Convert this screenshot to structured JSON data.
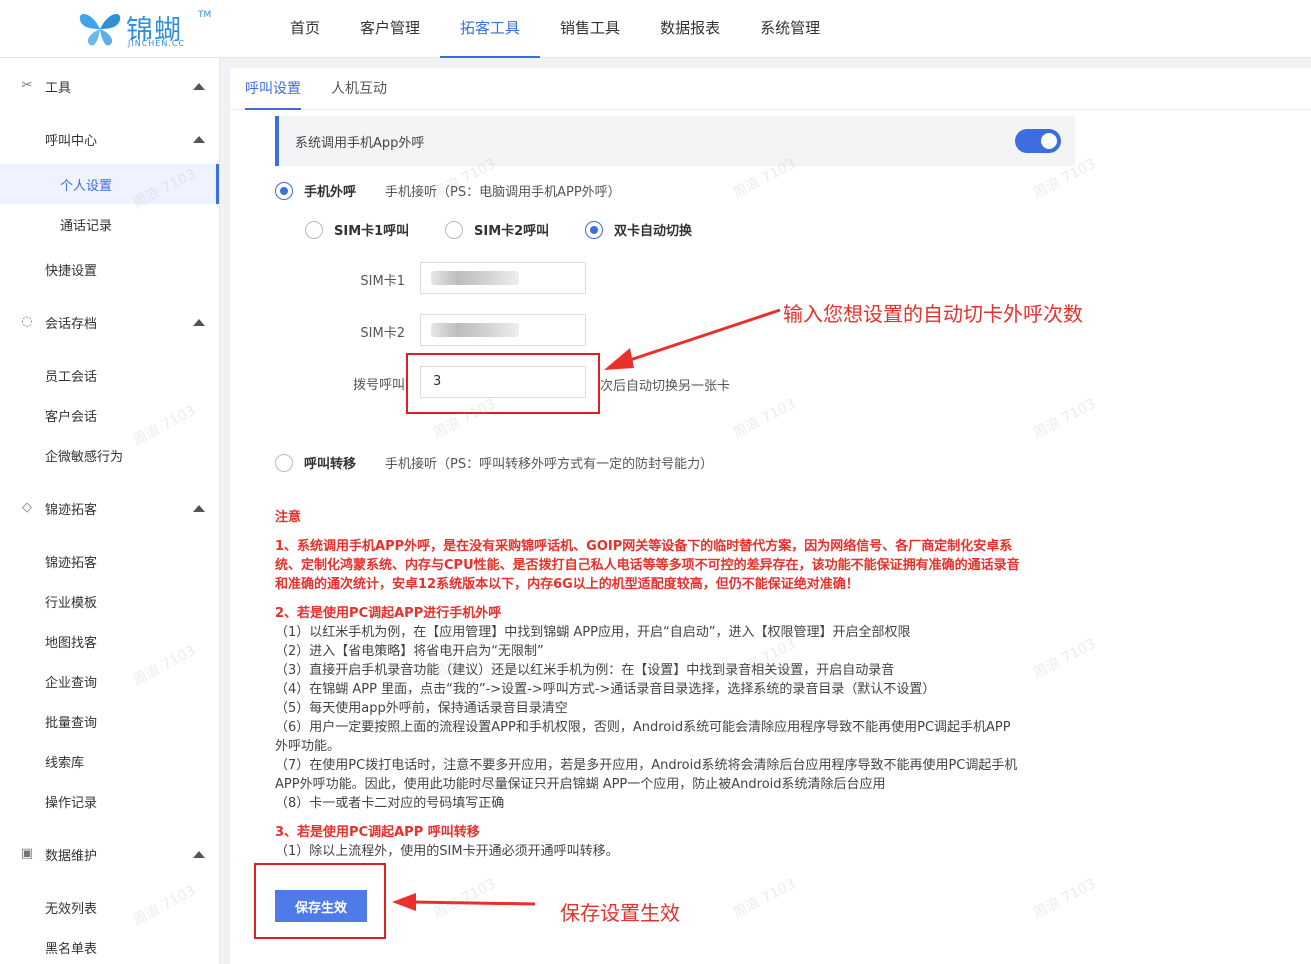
{
  "brand": {
    "name": "锦蝴",
    "tm": "TM",
    "sub": "JINCHEN.CC"
  },
  "nav": [
    {
      "label": "首页",
      "active": false
    },
    {
      "label": "客户管理",
      "active": false
    },
    {
      "label": "拓客工具",
      "active": true
    },
    {
      "label": "销售工具",
      "active": false
    },
    {
      "label": "数据报表",
      "active": false
    },
    {
      "label": "系统管理",
      "active": false
    }
  ],
  "sidebar": {
    "groups": [
      {
        "label": "工具",
        "icon": "tools-icon"
      },
      {
        "label": "会话存档",
        "icon": "chat-icon"
      },
      {
        "label": "锦迹拓客",
        "icon": "diamond-icon"
      },
      {
        "label": "数据维护",
        "icon": "database-icon"
      }
    ],
    "sub_call_center": "呼叫中心",
    "items": {
      "personal_settings": "个人设置",
      "call_records": "通话记录",
      "quick_settings": "快捷设置",
      "employee_chat": "员工会话",
      "customer_chat": "客户会话",
      "sensitive_behavior": "企微敏感行为",
      "jinji_tuoke": "锦迹拓客",
      "industry_template": "行业模板",
      "map_search": "地图找客",
      "enterprise_query": "企业查询",
      "batch_query": "批量查询",
      "leads_library": "线索库",
      "operation_log": "操作记录",
      "invalid_list": "无效列表",
      "blacklist": "黑名单表"
    }
  },
  "tabs": [
    {
      "label": "呼叫设置",
      "active": true
    },
    {
      "label": "人机互动",
      "active": false
    }
  ],
  "settings": {
    "app_call_label": "系统调用手机App外呼",
    "app_call_enabled": true,
    "mobile_call_label": "手机外呼",
    "mobile_call_hint": "手机接听（PS：电脑调用手机APP外呼）",
    "sim_options": [
      {
        "label": "SIM卡1呼叫",
        "checked": false
      },
      {
        "label": "SIM卡2呼叫",
        "checked": false
      },
      {
        "label": "双卡自动切换",
        "checked": true
      }
    ],
    "sim1_label": "SIM卡1",
    "sim2_label": "SIM卡2",
    "dial_label": "拨号呼叫",
    "dial_value": "3",
    "dial_suffix": "次后自动切换另一张卡",
    "forward_label": "呼叫转移",
    "forward_hint": "手机接听（PS：呼叫转移外呼方式有一定的防封号能力）"
  },
  "notes": {
    "title": "注意",
    "n1_lines": [
      "1、系统调用手机APP外呼，是在没有采购锦呼话机、GOIP网关等设备下的临时替代方案，因为网络信号、各厂商定制化安卓系",
      "统、定制化鸿蒙系统、内存与CPU性能、是否拨打自己私人电话等等多项不可控的差异存在，该功能不能保证拥有准确的通话录音",
      "和准确的通次统计，安卓12系统版本以下，内存6G以上的机型适配度较高，但仍不能保证绝对准确！"
    ],
    "n2_title": "2、若是使用PC调起APP进行手机外呼",
    "n2_lines": [
      "（1）以红米手机为例，在【应用管理】中找到锦蝴 APP应用，开启“自启动”，进入【权限管理】开启全部权限",
      "（2）进入【省电策略】将省电开启为“无限制”",
      "（3）直接开启手机录音功能（建议）还是以红米手机为例：在【设置】中找到录音相关设置，开启自动录音",
      "（4）在锦蝴 APP 里面，点击“我的”->设置->呼叫方式->通话录音目录选择，选择系统的录音目录（默认不设置）",
      "（5）每天使用app外呼前，保持通话录音目录清空",
      "（6）用户一定要按照上面的流程设置APP和手机权限，否则，Android系统可能会清除应用程序导致不能再使用PC调起手机APP",
      "外呼功能。",
      "（7）在使用PC拨打电话时，注意不要多开应用，若是多开应用，Android系统将会清除后台应用程序导致不能再使用PC调起手机",
      "APP外呼功能。因此，使用此功能时尽量保证只开启锦蝴 APP一个应用，防止被Android系统清除后台应用",
      "（8）卡一或者卡二对应的号码填写正确"
    ],
    "n3_title": "3、若是使用PC调起APP 呼叫转移",
    "n3_lines": [
      "（1）除以上流程外，使用的SIM卡开通必须开通呼叫转移。"
    ]
  },
  "save_button": "保存生效",
  "annotations": {
    "dial_tip": "输入您想设置的自动切卡外呼次数",
    "save_tip": "保存设置生效"
  },
  "watermark": "周浪 7103",
  "colors": {
    "accent": "#3c6ee0",
    "annotation": "#e8302c"
  }
}
